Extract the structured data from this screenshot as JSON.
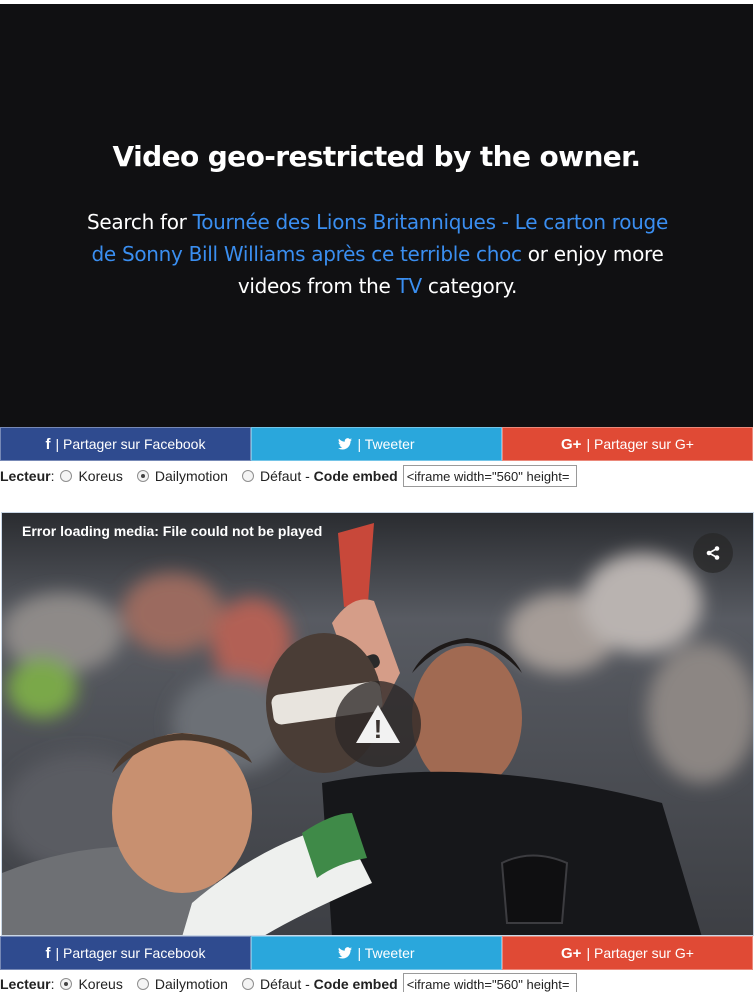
{
  "geo": {
    "title": "Video geo-restricted by the owner.",
    "text_prefix": "Search for ",
    "search_link": "Tournée des Lions Britanniques - Le carton rouge de Sonny Bill Williams après ce terrible choc",
    "text_middle": " or enjoy more videos from the ",
    "category_link": "TV",
    "text_suffix": " category."
  },
  "share": {
    "facebook_icon": "f",
    "facebook": "| Partager sur Facebook",
    "twitter": "| Tweeter",
    "google_icon": "G+",
    "google": "| Partager sur G+"
  },
  "player_top": {
    "label": "Lecteur",
    "sep": " :",
    "options": [
      "Koreus",
      "Dailymotion",
      "Défaut"
    ],
    "selected": "Dailymotion",
    "dash": " - ",
    "embed_label": "Code embed",
    "embed_value": "<iframe width=\"560\" height="
  },
  "media": {
    "error": "Error loading media: File could not be played",
    "share_icon": "share-icon",
    "warning_icon": "warning-icon",
    "warning_glyph": "!"
  },
  "player_bottom": {
    "label": "Lecteur",
    "sep": " :",
    "options": [
      "Koreus",
      "Dailymotion",
      "Défaut"
    ],
    "selected": "Koreus",
    "dash": " - ",
    "embed_label": "Code embed",
    "embed_value": "<iframe width=\"560\" height="
  },
  "colors": {
    "facebook": "#2f4b8f",
    "twitter": "#2aa7dc",
    "google": "#e04a35",
    "link": "#3a8ef0",
    "geo_bg": "#101012"
  }
}
